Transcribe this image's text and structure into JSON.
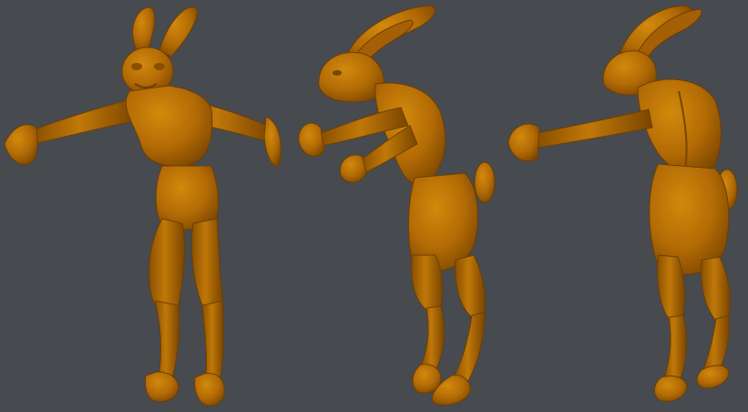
{
  "scene": {
    "background_color": "#474a4f",
    "material_color": "#b36b05",
    "material_shadow": "#6f3f00",
    "material_highlight": "#d8920f",
    "views": [
      {
        "name": "front-view"
      },
      {
        "name": "three-quarter-view"
      },
      {
        "name": "back-three-quarter-view"
      }
    ]
  }
}
